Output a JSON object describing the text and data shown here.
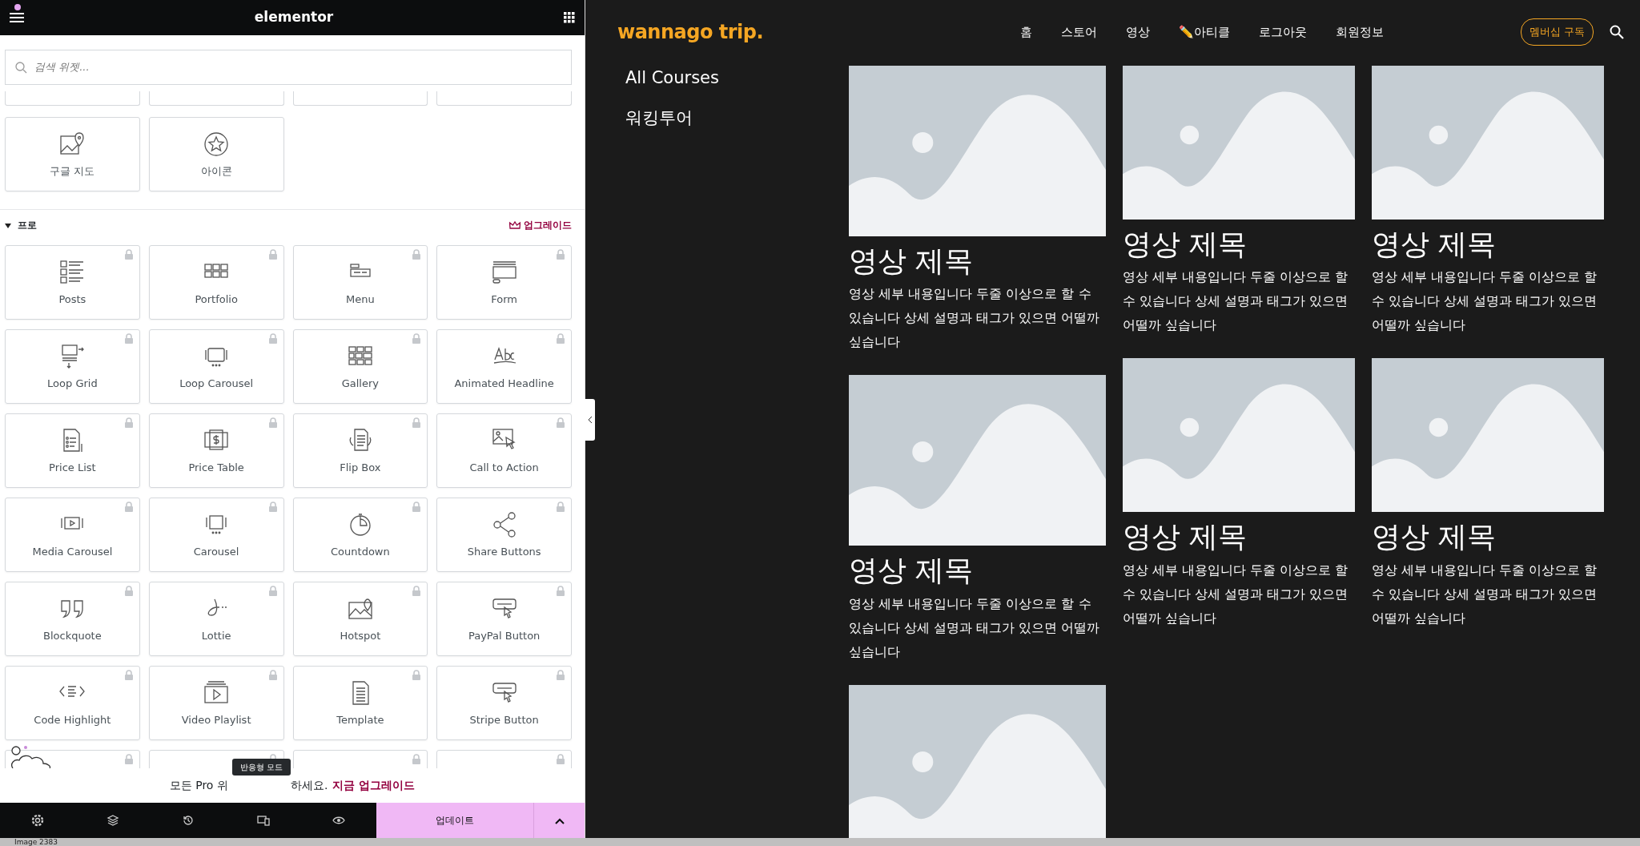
{
  "panel": {
    "logo": "elementor",
    "menu_badge": true,
    "search": {
      "placeholder": "검색 위젯..."
    },
    "basic_widgets": [
      {
        "label": "구글 지도"
      },
      {
        "label": "아이콘"
      }
    ],
    "pro_section": {
      "title": "프로",
      "expanded": true,
      "upgrade": "업그레이드"
    },
    "pro_widgets": [
      {
        "label": "Posts",
        "locked": true
      },
      {
        "label": "Portfolio",
        "locked": true
      },
      {
        "label": "Menu",
        "locked": true
      },
      {
        "label": "Form",
        "locked": true
      },
      {
        "label": "Loop Grid",
        "locked": true
      },
      {
        "label": "Loop Carousel",
        "locked": true
      },
      {
        "label": "Gallery",
        "locked": true
      },
      {
        "label": "Animated Headline",
        "locked": true
      },
      {
        "label": "Price List",
        "locked": true
      },
      {
        "label": "Price Table",
        "locked": true
      },
      {
        "label": "Flip Box",
        "locked": true
      },
      {
        "label": "Call to Action",
        "locked": true
      },
      {
        "label": "Media Carousel",
        "locked": true
      },
      {
        "label": "Carousel",
        "locked": true
      },
      {
        "label": "Countdown",
        "locked": true
      },
      {
        "label": "Share Buttons",
        "locked": true
      },
      {
        "label": "Blockquote",
        "locked": true
      },
      {
        "label": "Lottie",
        "locked": true
      },
      {
        "label": "Hotspot",
        "locked": true
      },
      {
        "label": "PayPal Button",
        "locked": true
      },
      {
        "label": "Code Highlight",
        "locked": true
      },
      {
        "label": "Video Playlist",
        "locked": true
      },
      {
        "label": "Template",
        "locked": true
      },
      {
        "label": "Stripe Button",
        "locked": true
      }
    ],
    "notice": {
      "before": "모든 Pro 위",
      "after": "하세요.",
      "link": "지금 업그레이드"
    },
    "tooltip": "반응형 모드",
    "footer": {
      "update": "업데이트"
    }
  },
  "site": {
    "logo": "wannago trip.",
    "nav": [
      "홈",
      "스토어",
      "영상",
      "✏️아티클",
      "로그아웃",
      "회원정보"
    ],
    "cta": "멤버십 구독",
    "sidebar": [
      "All Courses",
      "워킹투어"
    ],
    "columns": [
      [
        {
          "title": "영상 제목",
          "text": "영상 세부 내용입니다 두줄 이상으로 할 수 있습니다 상세 설명과 태그가 있으면 어떨까 싶습니다"
        },
        {
          "title": "영상 제목",
          "text": "영상 세부 내용입니다 두줄 이상으로 할 수 있습니다 상세 설명과 태그가 있으면 어떨까 싶습니다"
        },
        {
          "kind": "picture"
        }
      ],
      [
        {
          "title": "영상 제목",
          "text": "영상 세부 내용입니다 두줄 이상으로 할 수 있습니다 상세 설명과 태그가 있으면 어떨까 싶습니다"
        },
        {
          "title": "영상 제목",
          "text": "영상 세부 내용입니다 두줄 이상으로 할 수 있습니다 상세 설명과 태그가 있으면 어떨까 싶습니다"
        }
      ],
      [
        {
          "title": "영상 제목",
          "text": "영상 세부 내용입니다 두줄 이상으로 할 수 있습니다 상세 설명과 태그가 있으면 어떨까 싶습니다"
        },
        {
          "title": "영상 제목",
          "text": "영상 세부 내용입니다 두줄 이상으로 할 수 있습니다 상세 설명과 태그가 있으면 어떨까 싶습니다"
        }
      ]
    ]
  },
  "status": "Image 2383"
}
